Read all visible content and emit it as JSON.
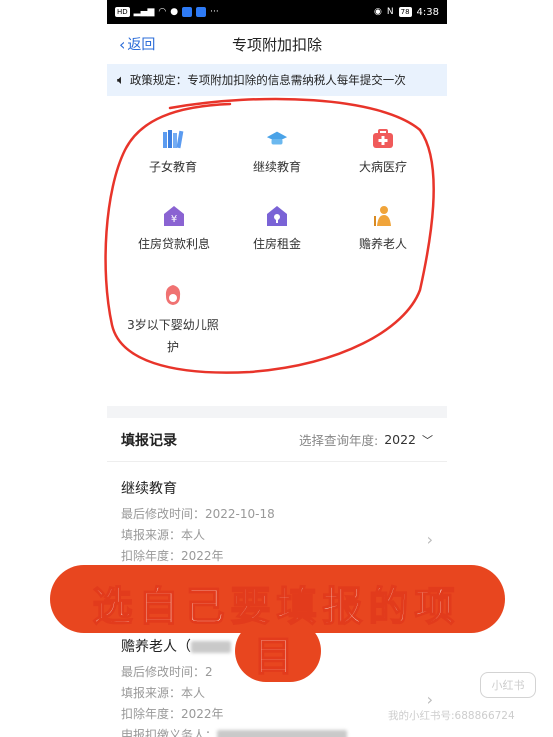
{
  "status": {
    "time": "4:38",
    "battery": "78"
  },
  "nav": {
    "back_label": "返回",
    "title": "专项附加扣除"
  },
  "notice": {
    "text": "政策规定：专项附加扣除的信息需纳税人每年提交一次"
  },
  "categories": [
    {
      "label": "子女教育",
      "icon": "books-icon",
      "color": "#5b9bf0"
    },
    {
      "label": "继续教育",
      "icon": "graduation-cap-icon",
      "color": "#4aa3e8"
    },
    {
      "label": "大病医疗",
      "icon": "medical-kit-icon",
      "color": "#f05a5a"
    },
    {
      "label": "住房贷款利息",
      "icon": "house-yuan-icon",
      "color": "#8a63d2"
    },
    {
      "label": "住房租金",
      "icon": "house-key-icon",
      "color": "#7a63d6"
    },
    {
      "label": "赡养老人",
      "icon": "elder-person-icon",
      "color": "#f0a43a"
    },
    {
      "label": "3岁以下婴幼儿照",
      "label2": "护",
      "icon": "mother-baby-icon",
      "color": "#f07272"
    }
  ],
  "records": {
    "title": "填报记录",
    "year_prompt": "选择查询年度:",
    "year_value": "2022",
    "items": [
      {
        "title": "继续教育",
        "modified": "最后修改时间：2022-10-18",
        "source": "填报来源：本人",
        "year": "扣除年度：2022年"
      },
      {
        "title": "赡养老人（",
        "modified": "最后修改时间：2",
        "source": "填报来源：本人",
        "year": "扣除年度：2022年",
        "extra": "申报扣缴义务人："
      }
    ]
  },
  "overlay": {
    "line1": "选自己要填报的项",
    "line2": "目"
  },
  "watermark": {
    "logo": "小红书",
    "text": "我的小红书号:688866724"
  }
}
